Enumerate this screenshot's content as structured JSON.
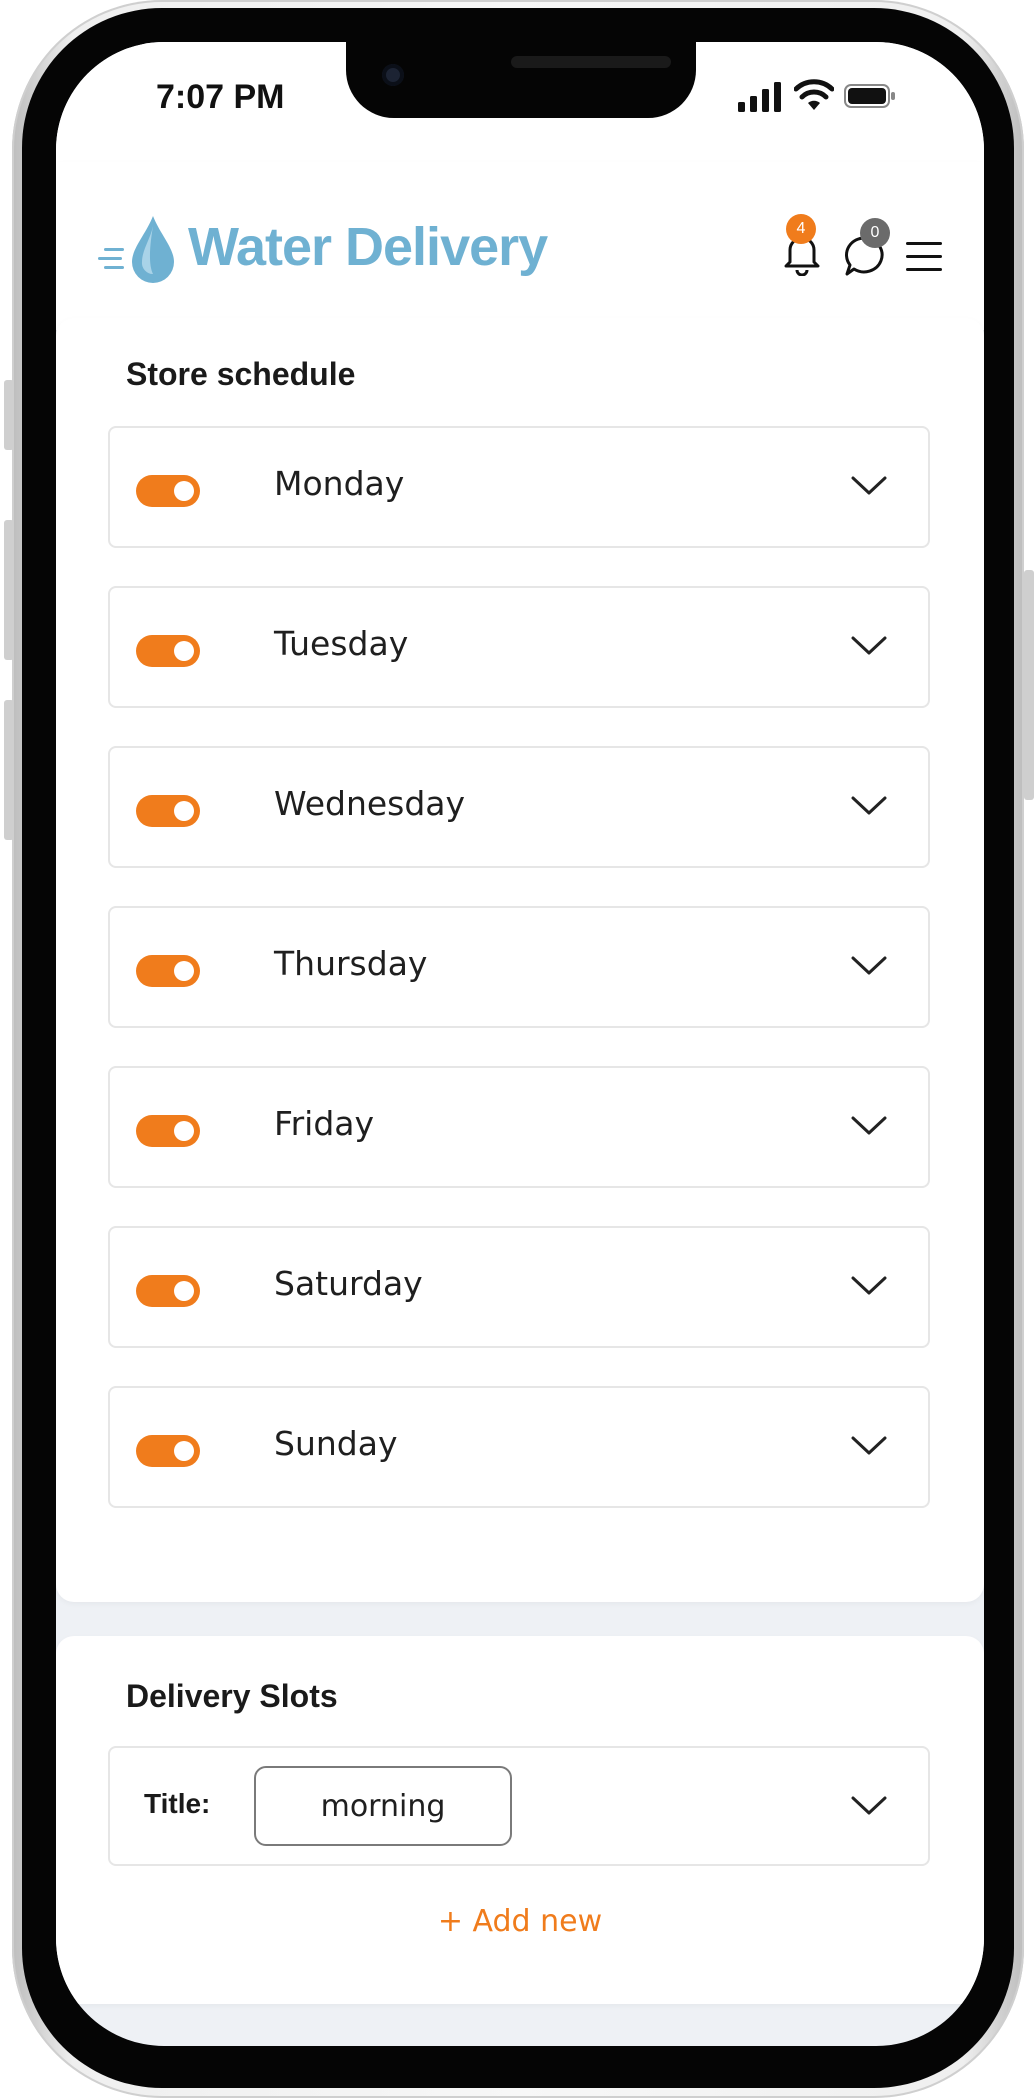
{
  "status_bar": {
    "time": "7:07 PM"
  },
  "header": {
    "app_name": "Water Delivery",
    "notifications_count": "4",
    "messages_count": "0"
  },
  "store_schedule": {
    "title": "Store schedule",
    "days": [
      {
        "label": "Monday",
        "enabled": true
      },
      {
        "label": "Tuesday",
        "enabled": true
      },
      {
        "label": "Wednesday",
        "enabled": true
      },
      {
        "label": "Thursday",
        "enabled": true
      },
      {
        "label": "Friday",
        "enabled": true
      },
      {
        "label": "Saturday",
        "enabled": true
      },
      {
        "label": "Sunday",
        "enabled": true
      }
    ]
  },
  "delivery_slots": {
    "title": "Delivery Slots",
    "slot_title_label": "Title:",
    "slot_title_value": "morning",
    "add_new_label": "+ Add new"
  },
  "colors": {
    "accent": "#f07c1c",
    "brand": "#6fb1d2",
    "badge_notifications": "#f07c1c",
    "badge_messages": "#6b6b6b"
  }
}
